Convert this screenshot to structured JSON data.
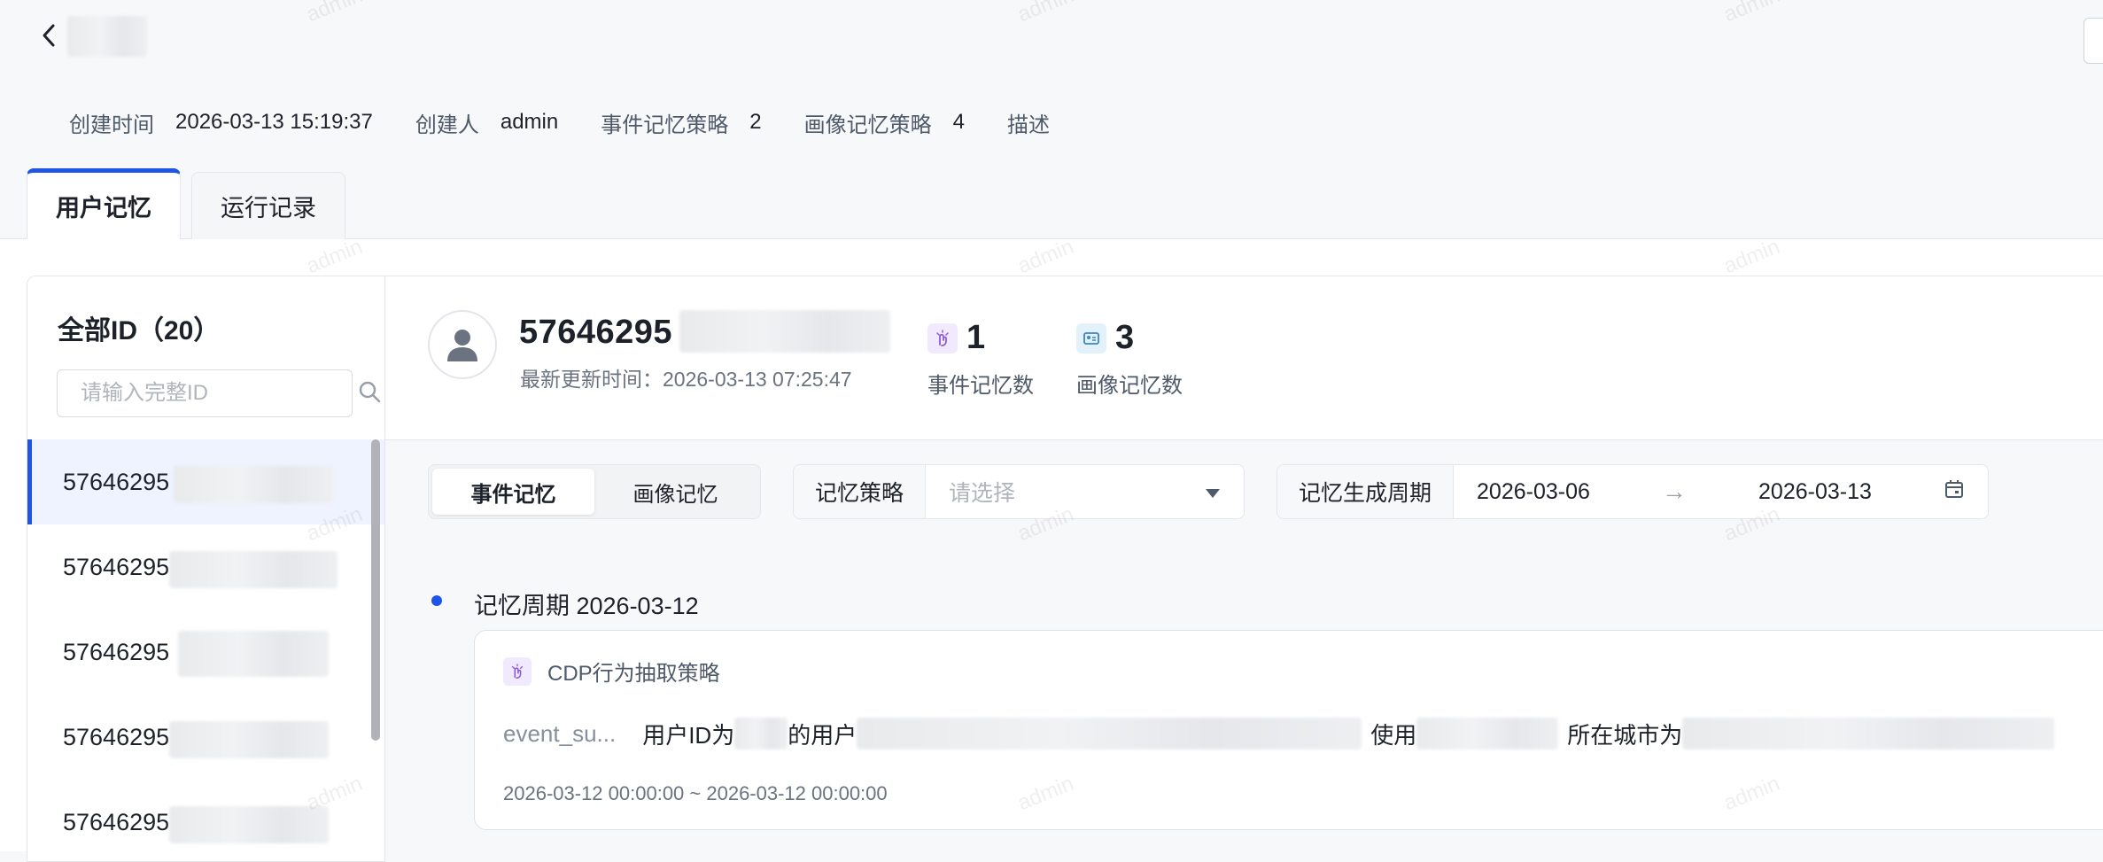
{
  "header": {
    "meta": [
      {
        "label": "创建时间",
        "value": "2026-03-13 15:19:37"
      },
      {
        "label": "创建人",
        "value": "admin"
      },
      {
        "label": "事件记忆策略",
        "value": "2"
      },
      {
        "label": "画像记忆策略",
        "value": "4"
      },
      {
        "label": "描述",
        "value": ""
      }
    ]
  },
  "tabs": [
    {
      "label": "用户记忆"
    },
    {
      "label": "运行记录"
    }
  ],
  "left": {
    "title": "全部ID（20）",
    "search_placeholder": "请输入完整ID",
    "items": [
      {
        "id": "57646295"
      },
      {
        "id": "57646295"
      },
      {
        "id": "57646295"
      },
      {
        "id": "57646295"
      },
      {
        "id": "57646295"
      }
    ]
  },
  "profile": {
    "user_id": "57646295",
    "update_time": "最新更新时间：2026-03-13 07:25:47",
    "event_count": "1",
    "event_label": "事件记忆数",
    "profile_count": "3",
    "profile_label": "画像记忆数"
  },
  "filters": {
    "seg_event": "事件记忆",
    "seg_profile": "画像记忆",
    "strategy_label": "记忆策略",
    "strategy_placeholder": "请选择",
    "period_label": "记忆生成周期",
    "start_date": "2026-03-06",
    "arrow": "→",
    "end_date": "2026-03-13"
  },
  "timeline": {
    "period_title": "记忆周期 2026-03-12",
    "card": {
      "strategy": "CDP行为抽取策略",
      "event_name": "event_su...",
      "text_1": "用户ID为",
      "text_2": "的用户",
      "text_3": "使用",
      "text_4": "所在城市为",
      "time_range": "2026-03-12 00:00:00 ~ 2026-03-12 00:00:00"
    }
  },
  "watermark": "admin",
  "colors": {
    "accent": "#1f55e6",
    "event_icon_bg": "#f1eafe",
    "profile_icon_bg": "#e3f1fb"
  }
}
